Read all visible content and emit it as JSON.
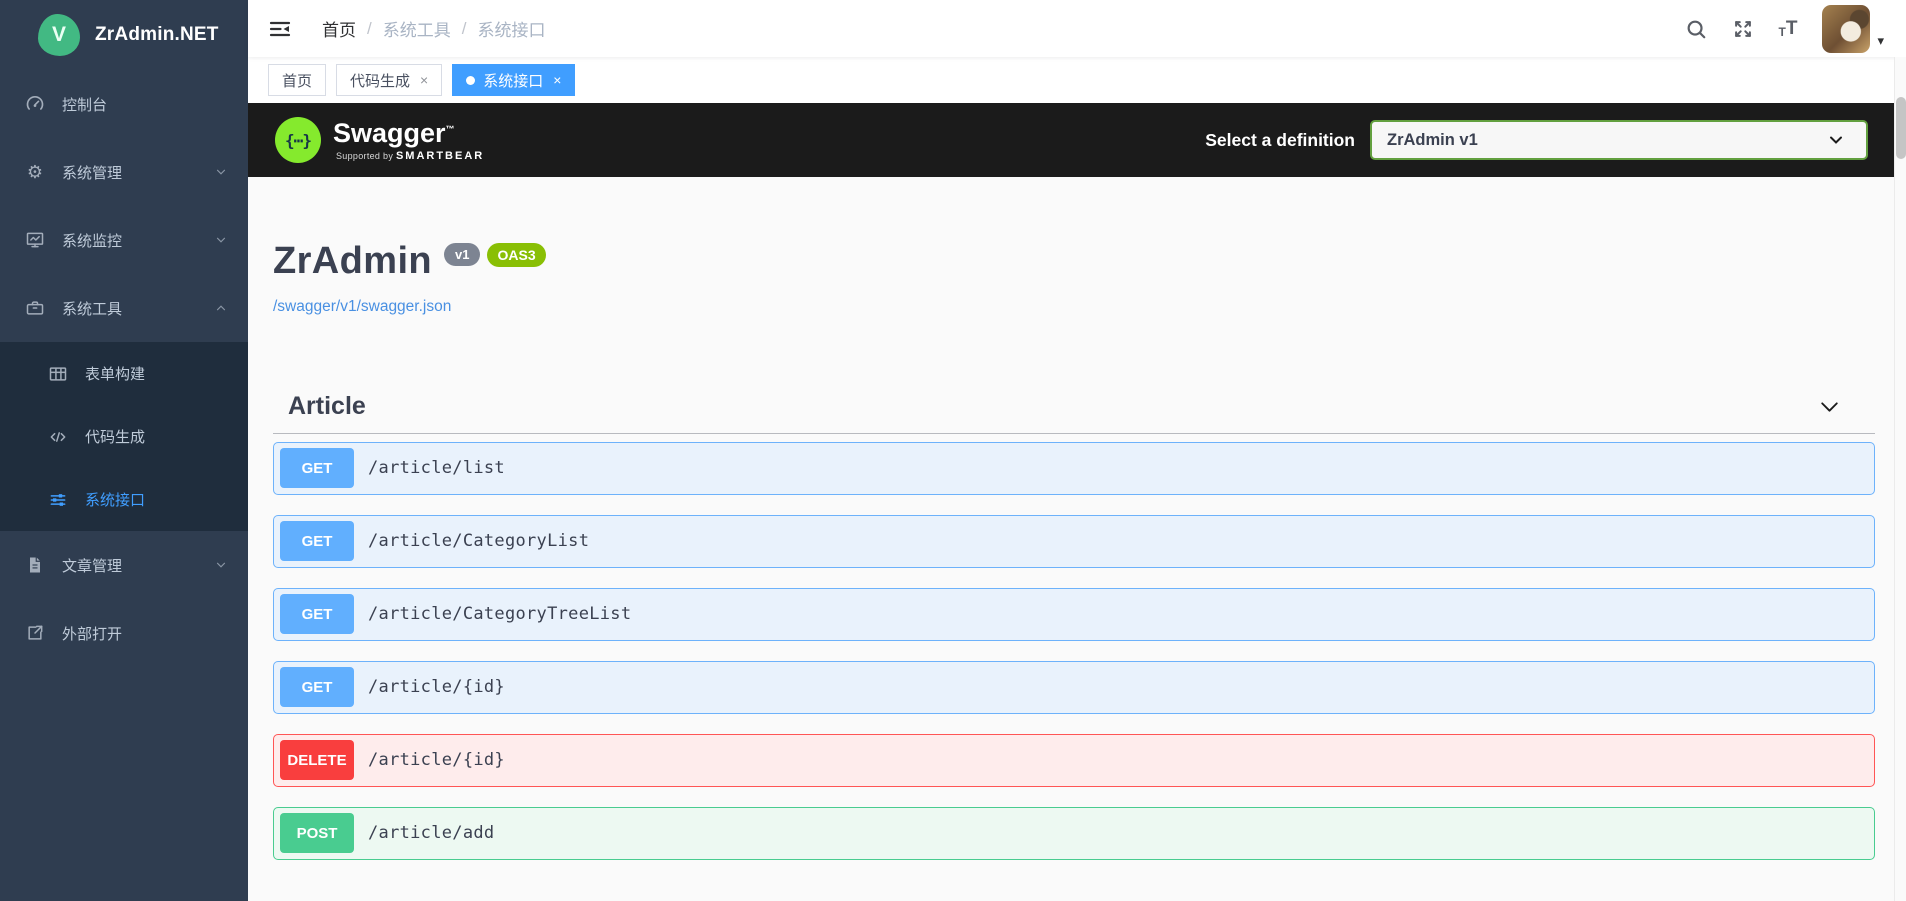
{
  "app": {
    "logo_letter": "V",
    "logo_text": "ZrAdmin.NET"
  },
  "sidebar": {
    "items": [
      {
        "label": "控制台"
      },
      {
        "label": "系统管理"
      },
      {
        "label": "系统监控"
      },
      {
        "label": "系统工具"
      },
      {
        "label": "文章管理"
      },
      {
        "label": "外部打开"
      }
    ],
    "sub_items": [
      {
        "label": "表单构建"
      },
      {
        "label": "代码生成"
      },
      {
        "label": "系统接口"
      }
    ]
  },
  "topbar": {
    "breadcrumb": [
      "首页",
      "系统工具",
      "系统接口"
    ],
    "separator": "/",
    "font_icon_small": "T",
    "font_icon_large": "T",
    "caret_glyph": "▾"
  },
  "tabs": {
    "items": [
      {
        "label": "首页"
      },
      {
        "label": "代码生成"
      },
      {
        "label": "系统接口"
      }
    ],
    "close_glyph": "×"
  },
  "swagger": {
    "logo_braces": "{⋯}",
    "logo_text": "Swagger",
    "logo_tm": "™",
    "supported_by": "Supported by",
    "smartbear": "SMARTBEAR",
    "select_label": "Select a definition",
    "select_value": "ZrAdmin v1",
    "title": "ZrAdmin",
    "version_badge": "v1",
    "oas_badge": "OAS3",
    "spec_link": "/swagger/v1/swagger.json",
    "section_title": "Article",
    "endpoints": [
      {
        "method": "GET",
        "path": "/article/list"
      },
      {
        "method": "GET",
        "path": "/article/CategoryList"
      },
      {
        "method": "GET",
        "path": "/article/CategoryTreeList"
      },
      {
        "method": "GET",
        "path": "/article/{id}"
      },
      {
        "method": "DELETE",
        "path": "/article/{id}"
      },
      {
        "method": "POST",
        "path": "/article/add"
      }
    ]
  },
  "colors": {
    "accent_blue": "#409eff",
    "sidebar_bg": "#2f3d50",
    "submenu_bg": "#1f2d3d",
    "swagger_topbar_bg": "#1b1b1b",
    "swagger_logo_green": "#85ea2d",
    "oas_badge_green": "#89bf04",
    "select_border_green": "#62a03f",
    "get_blue": "#61affe",
    "post_green": "#49cc90",
    "delete_red": "#f93e3e"
  }
}
